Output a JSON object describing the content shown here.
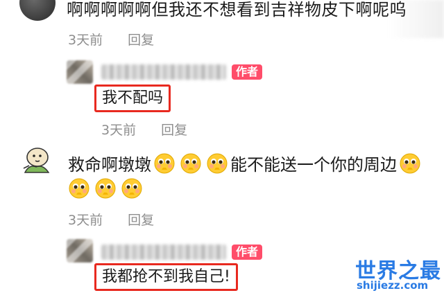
{
  "comments": [
    {
      "text": "啊啊啊啊啊但我还不想看到吉祥物皮下啊呢呜",
      "time": "3天前",
      "reply_label": "回复",
      "author_reply": {
        "badge": "作者",
        "text": "我不配吗",
        "time": "3天前",
        "reply_label": "回复"
      }
    },
    {
      "text_line1": "救命啊墩墩",
      "text_line1_tail": "能不能送一个你的周边",
      "time": "3天前",
      "reply_label": "回复",
      "author_reply": {
        "badge": "作者",
        "text": "我都抢不到我自己!"
      }
    }
  ],
  "watermark": {
    "title": "世界之最",
    "url": "shijiezz.com"
  },
  "colors": {
    "highlight_box": "#e8291f",
    "author_badge": "#ff4d6a",
    "meta_gray": "#8e8e8e",
    "watermark_blue": "#2a7be4"
  },
  "icons": {
    "pleading_emoji": "pleading-face-emoji",
    "commenter_avatar": "cartoon-character-avatar"
  }
}
